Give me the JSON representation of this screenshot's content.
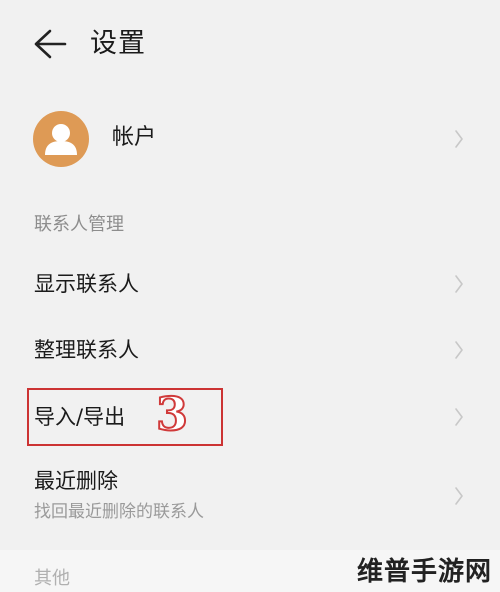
{
  "header": {
    "title": "设置"
  },
  "account": {
    "label": "帐户"
  },
  "contacts_section": {
    "header": "联系人管理",
    "items": [
      {
        "label": "显示联系人"
      },
      {
        "label": "整理联系人"
      },
      {
        "label": "导入/导出"
      },
      {
        "label": "最近删除",
        "sublabel": "找回最近删除的联系人"
      }
    ]
  },
  "other_section": {
    "header": "其他"
  },
  "annotation": {
    "step": "3"
  },
  "watermark": {
    "text": "维普手游网"
  },
  "colors": {
    "background": "#f1f1f1",
    "avatar": "#de9a55",
    "highlight": "#cc3333",
    "secondary_text": "#8d8d8d"
  },
  "icons": [
    "back-arrow-icon",
    "person-icon",
    "chevron-right-icon"
  ]
}
